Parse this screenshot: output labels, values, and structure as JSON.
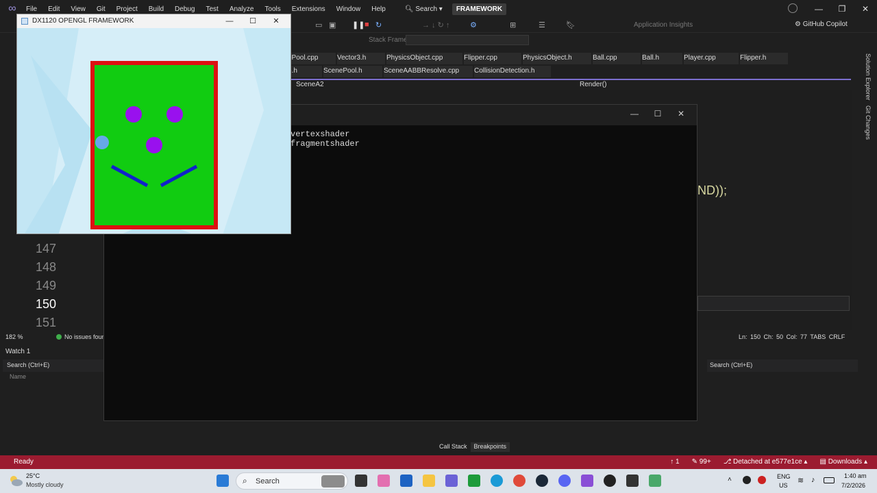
{
  "vs": {
    "menu": [
      "File",
      "Edit",
      "View",
      "Git",
      "Project",
      "Build",
      "Debug",
      "Test",
      "Analyze",
      "Tools",
      "Extensions",
      "Window",
      "Help"
    ],
    "search_label": "Search",
    "solution_name": "FRAMEWORK",
    "toolbar": {
      "stack_frame_label": "Stack Frame:",
      "app_insights": "Application Insights",
      "copilot": "GitHub Copilot"
    },
    "tabs_row1": [
      "ePool.cpp",
      "Vector3.h",
      "PhysicsObject.cpp",
      "Flipper.cpp",
      "PhysicsObject.h",
      "Ball.cpp",
      "Ball.h",
      "Player.cpp",
      "Flipper.h"
    ],
    "tabs_row2": [
      "o.h",
      "ScenePool.h",
      "SceneAABBResolve.cpp",
      "CollisionDetection.h"
    ],
    "nav": {
      "scope": "SceneA2",
      "member": "Render()"
    },
    "line_numbers": [
      "147",
      "148",
      "149",
      "150",
      "151"
    ],
    "current_line": "150",
    "code_fragment": "ND));",
    "editor_status": {
      "zoom": "182 %",
      "issues": "No issues foun",
      "position": "Ln: 150   Ch: 50   Col: 77   TABS   CRLF"
    },
    "watch": {
      "title": "Watch 1",
      "search_placeholder": "Search (Ctrl+E)",
      "column_name": "Name"
    },
    "right_panel": {
      "search_placeholder": "Search (Ctrl+E)"
    },
    "bottom_tabs": [
      "Call Stack",
      "Breakpoints"
    ],
    "side_labels": [
      "Solution Explorer",
      "Git Changes"
    ],
    "statusbar": {
      "ready": "Ready",
      "branch_count": "1",
      "changes": "99+",
      "detached": "Detached at e577e1ce",
      "downloads": "Downloads"
    }
  },
  "console": {
    "lines": [
      "vertexshader",
      "fragmentshader"
    ]
  },
  "gl_window": {
    "title": "DX1120 OPENGL FRAMEWORK",
    "colors": {
      "frame": "#dd1111",
      "playfield": "#11cc11",
      "bumper": "#9911ee",
      "ball": "#66a8e8",
      "flipper": "#1122cc"
    }
  },
  "taskbar": {
    "weather_temp": "25°C",
    "weather_desc": "Mostly cloudy",
    "search_label": "Search",
    "lang_line1": "ENG",
    "lang_line2": "US",
    "time": "1:40 am",
    "date": "7/2/2026"
  }
}
